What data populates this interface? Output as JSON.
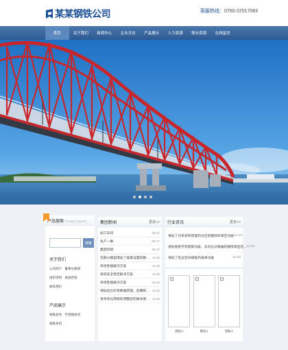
{
  "header": {
    "company_name": "某某钢铁公司",
    "hotline_label": "客服热线：",
    "hotline_number": "0760-22517083"
  },
  "nav": {
    "items": [
      {
        "label": "首页",
        "active": true
      },
      {
        "label": "关于我们",
        "active": false
      },
      {
        "label": "新闻中心",
        "active": false
      },
      {
        "label": "企业文化",
        "active": false
      },
      {
        "label": "产品展示",
        "active": false
      },
      {
        "label": "人力资源",
        "active": false
      },
      {
        "label": "联合资源",
        "active": false
      },
      {
        "label": "在线留言",
        "active": false
      }
    ]
  },
  "banner": {
    "subject": "red steel arch bridge over blue sea",
    "dots": 4,
    "active_dot": 2
  },
  "left_panel": {
    "search_title": "产品搜索",
    "search_subtitle": "Product Search",
    "search_placeholder": "",
    "search_button": "搜索",
    "about_title": "关于我们",
    "about_links": [
      "公司简介",
      "董事长致辞",
      "组织架构",
      "发展历程",
      "联系我们"
    ],
    "products_title": "产品展示",
    "product_links": [
      "钢铁系列",
      "不锈钢系列",
      "铸铁系列"
    ]
  },
  "news": {
    "title": "集团新闻",
    "more": "更多>>",
    "items": [
      {
        "title": "加工车间",
        "date": "06-17"
      },
      {
        "title": "生产一角",
        "date": "06-17"
      },
      {
        "title": "集团风貌",
        "date": "06-17"
      },
      {
        "title": "在部分模型增加了能量设置的删除等等的其他内容",
        "date": "11-03"
      },
      {
        "title": "系统性能解决方案",
        "date": "11-03"
      },
      {
        "title": "系统安全稳定解决方案",
        "date": "11-03"
      },
      {
        "title": "系统性能解决方案",
        "date": "11-03"
      },
      {
        "title": "增加后台栏目数据管理，后端管理系统，优化性能",
        "date": "11-03"
      },
      {
        "title": "发布优化网络的调整后的版本使用lpes方式",
        "date": "11-03"
      }
    ]
  },
  "industry": {
    "title": "行业资讯",
    "more": "更多>>",
    "items": [
      {
        "title": "增加了对系统和管理的对应的删除和清空功能",
        "date": "11-03"
      },
      {
        "title": "增加搜索字符提取功能，去优化对数据的删除等后定...",
        "date": "11-03"
      },
      {
        "title": "增加了后台空白模板的表单功能",
        "date": "11-03"
      }
    ]
  },
  "images": {
    "items": [
      {
        "caption": "图标2"
      },
      {
        "caption": "图标1"
      },
      {
        "caption": "图标4"
      }
    ]
  },
  "colors": {
    "brand_blue": "#1a4f95",
    "nav_blue": "#2d5a92",
    "accent_orange": "#f39a2b",
    "bridge_red": "#c8262a",
    "sky_blue": "#2f7fd0"
  }
}
